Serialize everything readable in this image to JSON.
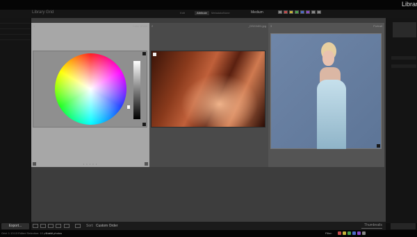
{
  "app": {
    "title": "Library"
  },
  "header": {
    "grid_title": "Library Grid",
    "tabs": [
      {
        "label": "Edit"
      },
      {
        "label": "Attribute",
        "active": true
      },
      {
        "label": "Metadata"
      },
      {
        "label": "None"
      }
    ],
    "filter_label": "Medium",
    "filter_colors": [
      "#888888",
      "#c24a4a",
      "#c8b43a",
      "#4aa04a",
      "#4a6ac8",
      "#8a4ac8",
      "#888888",
      "#888888"
    ]
  },
  "grid": {
    "cells": [
      {
        "index": "1",
        "title": "Color wheel",
        "bg": "#a7a7a7"
      },
      {
        "index": "2",
        "title": "_DSC0401.jpg",
        "bg": "#4a4a4a"
      },
      {
        "index": "3",
        "title": "Portrait",
        "bg": "#545454"
      }
    ]
  },
  "toolbar": {
    "export_label": "Export...",
    "sort_label": "Sort:",
    "sort_value": "Custom Order",
    "thumbnails_label": "Thumbnails"
  },
  "status": {
    "source": "Grid: 1.13.13 Edited Selection: 10 photos",
    "count": "3 of 8 photos",
    "filter_label": "Filter:",
    "flag_colors": [
      "#c24a4a",
      "#c8b43a",
      "#4aa04a",
      "#4a6ac8",
      "#8a4ac8",
      "#888888"
    ]
  }
}
